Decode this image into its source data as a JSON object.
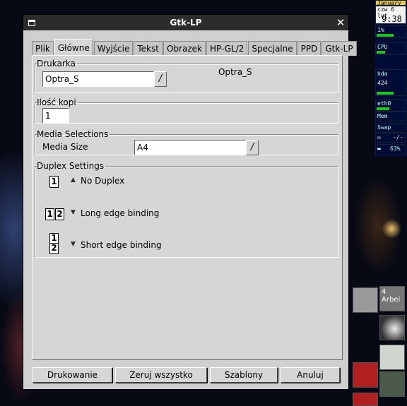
{
  "window": {
    "title": "Gtk-LP"
  },
  "tabs": [
    {
      "label": "Plik",
      "active": false
    },
    {
      "label": "Główne",
      "active": true
    },
    {
      "label": "Wyjście",
      "active": false
    },
    {
      "label": "Tekst",
      "active": false
    },
    {
      "label": "Obrazek",
      "active": false
    },
    {
      "label": "HP-GL/2",
      "active": false
    },
    {
      "label": "Specjalne",
      "active": false
    },
    {
      "label": "PPD",
      "active": false
    },
    {
      "label": "Gtk-LP",
      "active": false
    }
  ],
  "printer": {
    "legend": "Drukarka",
    "value": "Optra_S",
    "info": "Optra_S",
    "dropdown_glyph": "/"
  },
  "copies": {
    "legend": "Ilość kopi",
    "value": "1"
  },
  "media": {
    "legend": "Media Selections",
    "size_label": "Media Size",
    "size_value": "A4",
    "dropdown_glyph": "/"
  },
  "duplex": {
    "legend": "Duplex Settings",
    "options": [
      {
        "label": "No Duplex",
        "selected": true,
        "pages": [
          "1"
        ],
        "layout": "single"
      },
      {
        "label": "Long edge binding",
        "selected": false,
        "pages": [
          "1",
          "2"
        ],
        "layout": "side-by-side"
      },
      {
        "label": "Short edge binding",
        "selected": false,
        "pages": [
          "1",
          "2"
        ],
        "layout": "stacked"
      }
    ]
  },
  "buttons": {
    "print": "Drukowanie",
    "reset": "Zeruj wszystko",
    "templates": "Szablony",
    "cancel": "Anuluj"
  },
  "dock": {
    "calendar_month": "January",
    "calendar_day": "czw 6 lut",
    "clock": "9:38",
    "cpu_percent": "1%",
    "cpu_label": "CPU",
    "disk_label": "hda",
    "disk_value": "424",
    "net_label": "eth0",
    "mem_label": "Mem",
    "swap_label": "Swap",
    "mail_status": "-/-",
    "battery_percent": "63%",
    "workspace_number": "4",
    "workspace_label": "Arbei"
  }
}
